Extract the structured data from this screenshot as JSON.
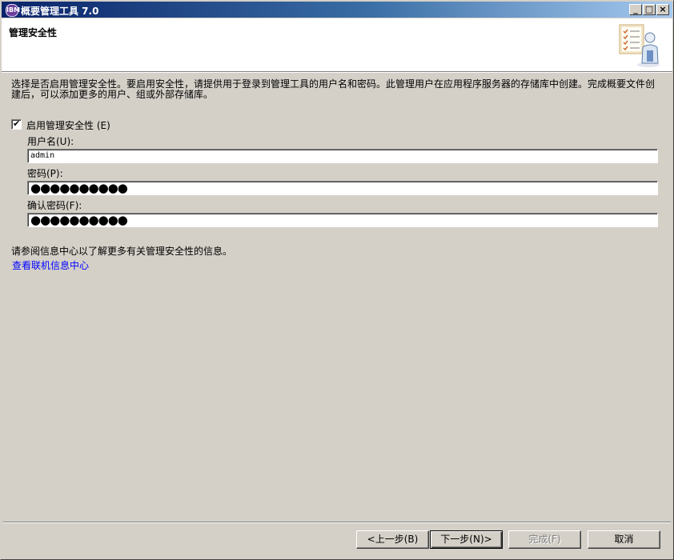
{
  "window": {
    "title": "概要管理工具 7.0",
    "app_icon_text": "IBM",
    "controls": {
      "minimize": "_",
      "maximize": "□",
      "close": "×"
    }
  },
  "header": {
    "title": "管理安全性",
    "art_icon": "wizard-user-icon"
  },
  "description": "选择是否启用管理安全性。要启用安全性，请提供用于登录到管理工具的用户名和密码。此管理用户在应用程序服务器的存储库中创建。完成概要文件创建后，可以添加更多的用户、组或外部存储库。",
  "security": {
    "enable_label": "启用管理安全性 (E)",
    "enabled": true,
    "username_label": "用户名(U):",
    "username_value": "admin",
    "password_label": "密码(P):",
    "password_mask": "●●●●●●●●●●",
    "confirm_label": "确认密码(F):",
    "confirm_mask": "●●●●●●●●●●"
  },
  "info": {
    "text": "请参阅信息中心以了解更多有关管理安全性的信息。",
    "link": "查看联机信息中心"
  },
  "buttons": {
    "back": "<上一步(B)",
    "next": "下一步(N)>",
    "finish": "完成(F)",
    "cancel": "取消"
  }
}
